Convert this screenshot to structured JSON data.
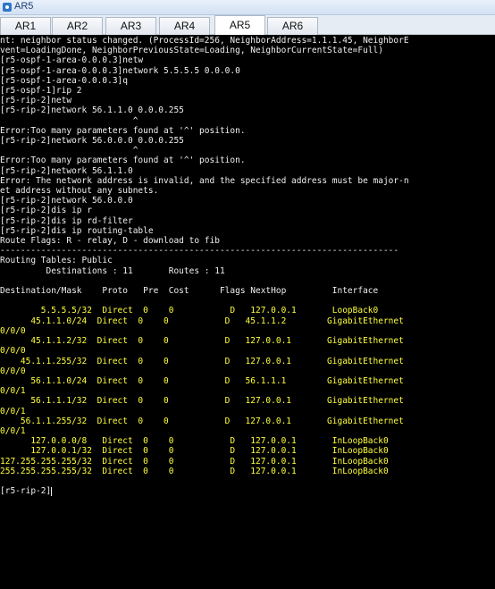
{
  "window": {
    "title": "AR5",
    "icon": "router-app-icon"
  },
  "tabs": [
    {
      "label": "AR1",
      "active": false
    },
    {
      "label": "AR2",
      "active": false
    },
    {
      "label": "AR3",
      "active": false
    },
    {
      "label": "AR4",
      "active": false
    },
    {
      "label": "AR5",
      "active": true
    },
    {
      "label": "AR6",
      "active": false
    }
  ],
  "terminal": {
    "lines": [
      "nt: neighbor status changed. (ProcessId=256, NeighborAddress=1.1.1.45, NeighborE",
      "vent=LoadingDone, NeighborPreviousState=Loading, NeighborCurrentState=Full)",
      "[r5-ospf-1-area-0.0.0.3]netw",
      "[r5-ospf-1-area-0.0.0.3]network 5.5.5.5 0.0.0.0",
      "[r5-ospf-1-area-0.0.0.3]q",
      "[r5-ospf-1]rip 2",
      "[r5-rip-2]netw",
      "[r5-rip-2]network 56.1.1.0 0.0.0.255",
      "                          ^",
      "Error:Too many parameters found at '^' position.",
      "[r5-rip-2]network 56.0.0.0 0.0.0.255",
      "                          ^",
      "Error:Too many parameters found at '^' position.",
      "[r5-rip-2]network 56.1.1.0",
      "Error: The network address is invalid, and the specified address must be major-n",
      "et address without any subnets.",
      "[r5-rip-2]network 56.0.0.0",
      "[r5-rip-2]dis ip r",
      "[r5-rip-2]dis ip rd-filter",
      "[r5-rip-2]dis ip routing-table",
      "Route Flags: R - relay, D - download to fib",
      "------------------------------------------------------------------------------",
      "Routing Tables: Public",
      "         Destinations : 11       Routes : 11",
      "",
      "Destination/Mask    Proto   Pre  Cost      Flags NextHop         Interface",
      "",
      "        5.5.5.5/32  Direct  0    0           D   127.0.0.1       LoopBack0",
      "      45.1.1.0/24  Direct  0    0           D   45.1.1.2        GigabitEthernet",
      "0/0/0",
      "      45.1.1.2/32  Direct  0    0           D   127.0.0.1       GigabitEthernet",
      "0/0/0",
      "    45.1.1.255/32  Direct  0    0           D   127.0.0.1       GigabitEthernet",
      "0/0/0",
      "      56.1.1.0/24  Direct  0    0           D   56.1.1.1        GigabitEthernet",
      "0/0/1",
      "      56.1.1.1/32  Direct  0    0           D   127.0.0.1       GigabitEthernet",
      "0/0/1",
      "    56.1.1.255/32  Direct  0    0           D   127.0.0.1       GigabitEthernet",
      "0/0/1",
      "      127.0.0.0/8   Direct  0    0           D   127.0.0.1       InLoopBack0",
      "      127.0.0.1/32  Direct  0    0           D   127.0.0.1       InLoopBack0",
      "127.255.255.255/32  Direct  0    0           D   127.0.0.1       InLoopBack0",
      "255.255.255.255/32  Direct  0    0           D   127.0.0.1       InLoopBack0",
      "",
      "[r5-rip-2]"
    ],
    "colors": {
      "text": "#f0f0f0",
      "highlight": "#ffff3c",
      "background": "#000000"
    }
  }
}
